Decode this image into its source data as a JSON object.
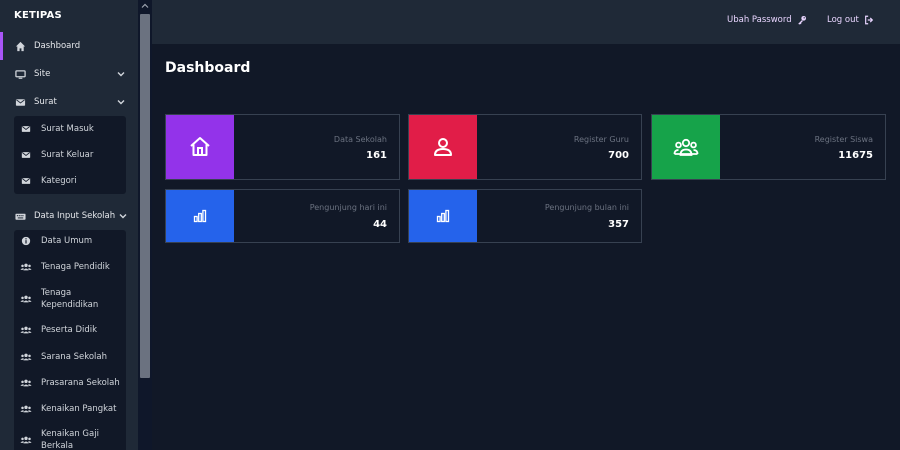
{
  "brand": "KETIPAS",
  "sidebar": {
    "dashboard": "Dashboard",
    "site": "Site",
    "surat": "Surat",
    "surat_items": [
      "Surat Masuk",
      "Surat Keluar",
      "Kategori"
    ],
    "data_input": "Data Input Sekolah",
    "data_input_items": [
      "Data Umum",
      "Tenaga Pendidik",
      "Tenaga\nKependidikan",
      "Peserta Didik",
      "Sarana Sekolah",
      "Prasarana Sekolah",
      "Kenaikan Pangkat",
      "Kenaikan Gaji\nBerkala"
    ]
  },
  "header": {
    "change_password": "Ubah Password",
    "logout": "Log out"
  },
  "page_title": "Dashboard",
  "cards": [
    {
      "label": "Data Sekolah",
      "value": "161",
      "color": "#9333ea",
      "icon": "home-icon"
    },
    {
      "label": "Register Guru",
      "value": "700",
      "color": "#e11d48",
      "icon": "user-icon"
    },
    {
      "label": "Register Siswa",
      "value": "11675",
      "color": "#16a34a",
      "icon": "users-icon"
    },
    {
      "label": "Pengunjung hari ini",
      "value": "44",
      "color": "#2563eb",
      "icon": "bar-chart-icon"
    },
    {
      "label": "Pengunjung bulan ini",
      "value": "357",
      "color": "#2563eb",
      "icon": "bar-chart-icon"
    }
  ]
}
